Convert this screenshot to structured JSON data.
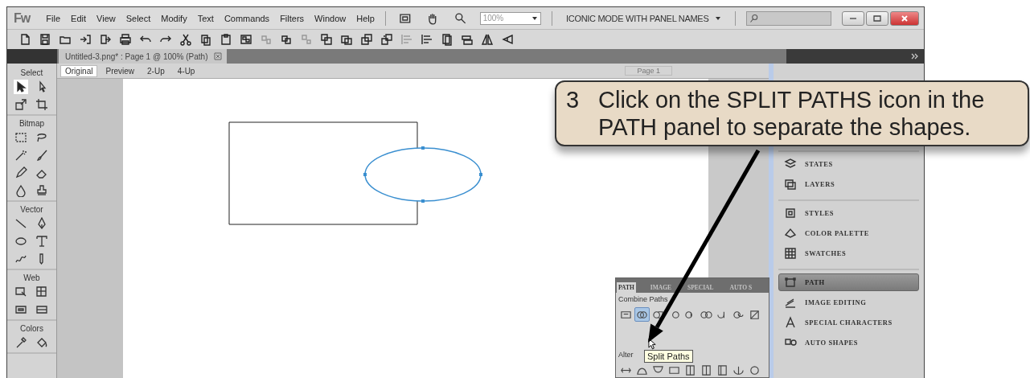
{
  "menu_bar": {
    "logo": "Fw",
    "menus": [
      "File",
      "Edit",
      "View",
      "Select",
      "Modify",
      "Text",
      "Commands",
      "Filters",
      "Window",
      "Help"
    ],
    "zoom": "100%",
    "workspace": "ICONIC MODE WITH PANEL NAMES"
  },
  "document_tab": {
    "title": "Untitled-3.png* : Page 1 @ 100% (Path)"
  },
  "tools": [
    {
      "title": "Select",
      "tools": [
        {
          "selected": true
        },
        {
          "selected": false
        },
        {
          "selected": false
        },
        {
          "selected": false
        }
      ]
    },
    {
      "title": "Bitmap",
      "tools": [
        {
          "selected": false
        },
        {
          "selected": false
        },
        {
          "selected": false
        },
        {
          "selected": false
        },
        {
          "selected": false
        },
        {
          "selected": false
        },
        {
          "selected": false
        },
        {
          "selected": false
        }
      ]
    },
    {
      "title": "Vector",
      "tools": [
        {
          "selected": false
        },
        {
          "selected": false
        },
        {
          "selected": false
        },
        {
          "selected": false
        },
        {
          "selected": false
        },
        {
          "selected": false
        }
      ]
    },
    {
      "title": "Web",
      "tools": [
        {
          "selected": false
        },
        {
          "selected": false
        },
        {
          "selected": false
        },
        {
          "selected": false
        }
      ]
    },
    {
      "title": "Colors",
      "tools": [
        {
          "selected": false
        },
        {
          "selected": false
        }
      ]
    }
  ],
  "view_tabs": [
    {
      "label": "Original",
      "selected": true
    },
    {
      "label": "Preview",
      "selected": false
    },
    {
      "label": "2-Up",
      "selected": false
    },
    {
      "label": "4-Up",
      "selected": false
    }
  ],
  "page_selector": "Page 1",
  "dock": {
    "groups": [
      {
        "items": [
          {
            "label": "STATES",
            "selected": false
          },
          {
            "label": "LAYERS",
            "selected": false
          }
        ]
      },
      {
        "items": [
          {
            "label": "STYLES",
            "selected": false
          },
          {
            "label": "COLOR PALETTE",
            "selected": false
          },
          {
            "label": "SWATCHES",
            "selected": false
          }
        ]
      },
      {
        "items": [
          {
            "label": "PATH",
            "selected": true
          },
          {
            "label": "IMAGE EDITING",
            "selected": false
          },
          {
            "label": "SPECIAL CHARACTERS",
            "selected": false
          },
          {
            "label": "AUTO SHAPES",
            "selected": false
          }
        ]
      }
    ]
  },
  "path_panel": {
    "tabs": [
      {
        "label": "PATH",
        "selected": true
      },
      {
        "label": "IMAGE",
        "selected": false
      },
      {
        "label": "SPECIAL",
        "selected": false
      },
      {
        "label": "AUTO S",
        "selected": false
      }
    ],
    "sections": [
      {
        "label": "Combine Paths",
        "buttons": [
          {
            "highlighted": false
          },
          {
            "highlighted": true
          },
          {
            "highlighted": false
          },
          {
            "highlighted": false
          },
          {
            "highlighted": false
          },
          {
            "highlighted": false
          },
          {
            "highlighted": false
          },
          {
            "highlighted": false
          },
          {
            "highlighted": false
          }
        ]
      },
      {
        "label": "Alter",
        "buttons": [
          {
            "highlighted": false
          },
          {
            "highlighted": false
          },
          {
            "highlighted": false
          },
          {
            "highlighted": false
          },
          {
            "highlighted": false
          },
          {
            "highlighted": false
          },
          {
            "highlighted": false
          },
          {
            "highlighted": false
          },
          {
            "highlighted": false
          }
        ]
      }
    ],
    "tooltip": "Split Paths"
  },
  "callout": {
    "number": "3",
    "text": "Click on the SPLIT PATHS icon in the PATH panel to separate the shapes."
  }
}
